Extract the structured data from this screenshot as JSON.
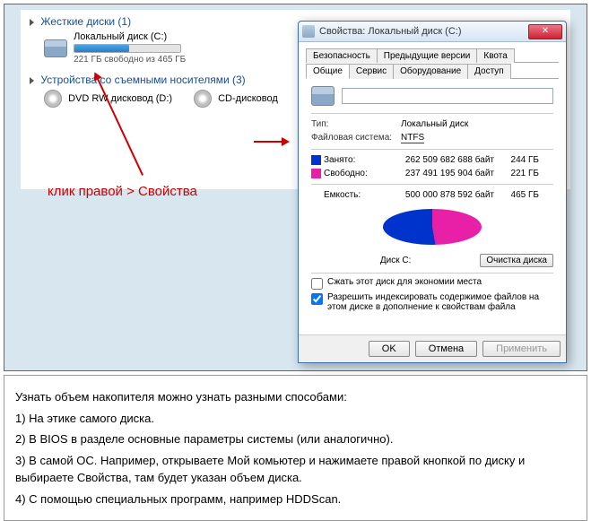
{
  "explorer": {
    "section_hdd": "Жесткие диски (1)",
    "hdd_name": "Локальный диск (C:)",
    "hdd_free": "221 ГБ свободно из 465 ГБ",
    "section_removable": "Устройства со съемными носителями (3)",
    "dvd_name": "DVD RW дисковод (D:)",
    "cd_name": "CD-дисковод"
  },
  "annotation": "клик правой > Свойства",
  "dialog": {
    "title": "Свойства: Локальный диск (C:)",
    "tabs": {
      "security": "Безопасность",
      "prev": "Предыдущие версии",
      "quota": "Квота",
      "general": "Общие",
      "service": "Сервис",
      "hardware": "Оборудование",
      "access": "Доступ"
    },
    "type_label": "Тип:",
    "type_value": "Локальный диск",
    "fs_label": "Файловая система:",
    "fs_value": "NTFS",
    "used_label": "Занято:",
    "used_bytes": "262 509 682 688 байт",
    "used_gb": "244 ГБ",
    "free_label": "Свободно:",
    "free_bytes": "237 491 195 904 байт",
    "free_gb": "221 ГБ",
    "capacity_label": "Емкость:",
    "capacity_bytes": "500 000 878 592 байт",
    "capacity_gb": "465 ГБ",
    "disk_label": "Диск C:",
    "clean_btn": "Очистка диска",
    "compress": "Сжать этот диск для экономии места",
    "index": "Разрешить индексировать содержимое файлов на этом диске в дополнение к свойствам файла",
    "ok": "OK",
    "cancel": "Отмена",
    "apply": "Применить"
  },
  "instructions": {
    "intro": "Узнать объем накопителя можно узнать разными способами:",
    "p1": "1) На этике самого диска.",
    "p2": "2) В BIOS в разделе основные параметры системы (или аналогично).",
    "p3": "3) В самой ОС. Например, открываете Мой комьютер и нажимаете правой кнопкой по диску и выбираете Свойства, там будет указан объем диска.",
    "p4": "4) С помощью специальных программ, например HDDScan."
  },
  "chart_data": {
    "type": "pie",
    "title": "Диск C:",
    "series": [
      {
        "name": "Занято",
        "value_bytes": 262509682688,
        "value_gb": 244,
        "color": "#0033cc"
      },
      {
        "name": "Свободно",
        "value_bytes": 237491195904,
        "value_gb": 221,
        "color": "#e820a8"
      }
    ],
    "total_bytes": 500000878592,
    "total_gb": 465
  }
}
